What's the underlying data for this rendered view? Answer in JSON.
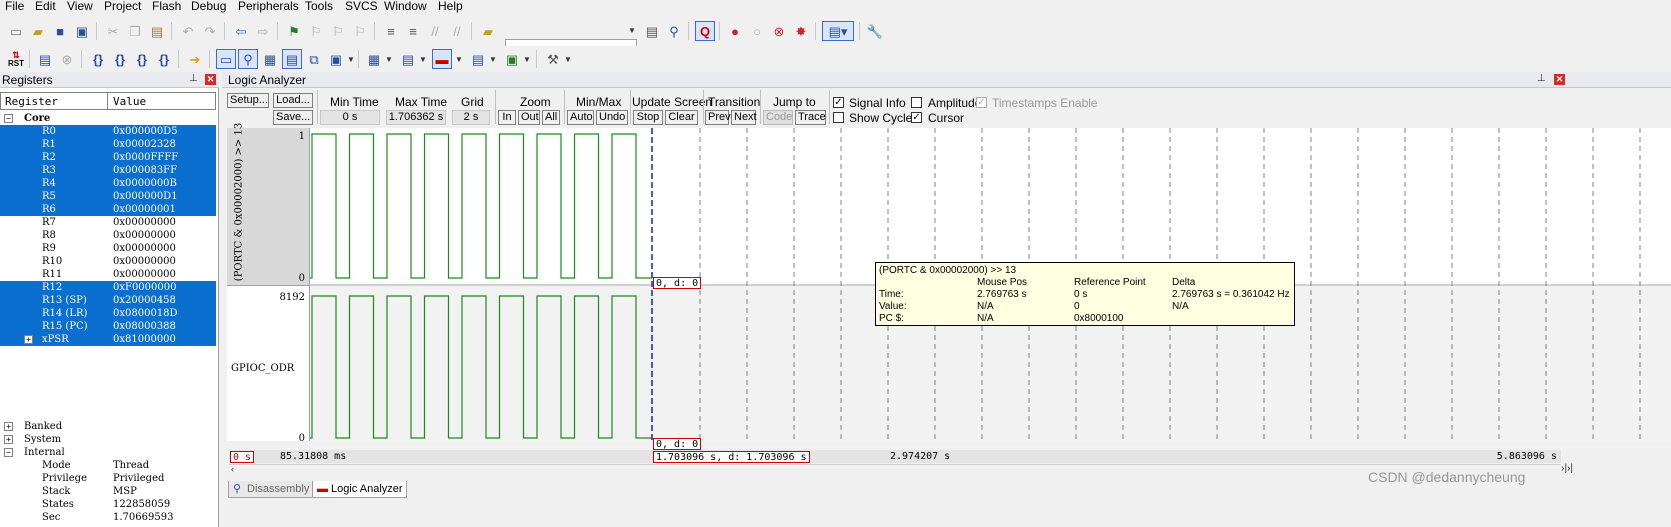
{
  "menu": [
    "File",
    "Edit",
    "View",
    "Project",
    "Flash",
    "Debug",
    "Peripherals",
    "Tools",
    "SVCS",
    "Window",
    "Help"
  ],
  "toolbar2": {
    "rst_label": "RST"
  },
  "registers": {
    "title": "Registers",
    "col_register": "Register",
    "col_value": "Value",
    "core_label": "Core",
    "rows": [
      {
        "name": "R0",
        "value": "0x000000D5",
        "selected": true
      },
      {
        "name": "R1",
        "value": "0x00002328",
        "selected": true
      },
      {
        "name": "R2",
        "value": "0x0000FFFF",
        "selected": true
      },
      {
        "name": "R3",
        "value": "0x000083FF",
        "selected": true
      },
      {
        "name": "R4",
        "value": "0x0000000B",
        "selected": true
      },
      {
        "name": "R5",
        "value": "0x000000D1",
        "selected": true
      },
      {
        "name": "R6",
        "value": "0x00000001",
        "selected": true
      },
      {
        "name": "R7",
        "value": "0x00000000",
        "selected": false
      },
      {
        "name": "R8",
        "value": "0x00000000",
        "selected": false
      },
      {
        "name": "R9",
        "value": "0x00000000",
        "selected": false
      },
      {
        "name": "R10",
        "value": "0x00000000",
        "selected": false
      },
      {
        "name": "R11",
        "value": "0x00000000",
        "selected": false
      },
      {
        "name": "R12",
        "value": "0xF0000000",
        "selected": true
      },
      {
        "name": "R13 (SP)",
        "value": "0x20000458",
        "selected": true
      },
      {
        "name": "R14 (LR)",
        "value": "0x0800018D",
        "selected": true
      },
      {
        "name": "R15 (PC)",
        "value": "0x08000388",
        "selected": true
      },
      {
        "name": "xPSR",
        "value": "0x81000000",
        "selected": true
      }
    ],
    "groups": [
      "Banked",
      "System",
      "Internal"
    ],
    "internal": [
      {
        "name": "Mode",
        "value": "Thread"
      },
      {
        "name": "Privilege",
        "value": "Privileged"
      },
      {
        "name": "Stack",
        "value": "MSP"
      },
      {
        "name": "States",
        "value": "122858059"
      },
      {
        "name": "Sec",
        "value": "1.70669593"
      }
    ]
  },
  "logic_analyzer": {
    "title": "Logic Analyzer",
    "setup": "Setup...",
    "load": "Load...",
    "save": "Save...",
    "min_time_label": "Min Time",
    "min_time": "0 s",
    "max_time_label": "Max Time",
    "max_time": "1.706362 s",
    "grid_label": "Grid",
    "grid": "2 s",
    "zoom_label": "Zoom",
    "zoom_in": "In",
    "zoom_out": "Out",
    "zoom_all": "All",
    "minmax_label": "Min/Max",
    "auto": "Auto",
    "undo": "Undo",
    "update_label": "Update Screen",
    "stop": "Stop",
    "clear": "Clear",
    "transition_label": "Transition",
    "prev": "Prev",
    "next": "Next",
    "jump_label": "Jump to",
    "code": "Code",
    "trace": "Trace",
    "signal_info": "Signal Info",
    "show_cycles": "Show Cycles",
    "amplitude": "Amplitude",
    "cursor": "Cursor",
    "timestamps": "Timestamps Enable",
    "signal_info_checked": true,
    "show_cycles_checked": false,
    "amplitude_checked": false,
    "cursor_checked": true,
    "timestamps_checked": true,
    "signals": [
      {
        "name": "(PORTC & 0x00002000) >> 13",
        "max": "1",
        "min": "0",
        "readout": "0,  d: 0"
      },
      {
        "name": "GPIOC_ODR",
        "max": "8192",
        "min": "0",
        "readout": "0,  d: 0"
      }
    ],
    "pulse_count": 9,
    "tooltip": {
      "signal": "(PORTC & 0x00002000) >> 13",
      "col_mouse": "Mouse Pos",
      "col_ref": "Reference Point",
      "col_delta": "Delta",
      "row_time": "Time:",
      "row_value": "Value:",
      "row_pc": "PC $:",
      "time_mouse": "2.769763 s",
      "time_ref": "0 s",
      "time_delta": "2.769763 s = 0.361042 Hz",
      "value_mouse": "N/A",
      "value_ref": "0",
      "value_delta": "N/A",
      "pc_mouse": "N/A",
      "pc_ref": "0x8000100"
    },
    "timebar": {
      "start": "0 s",
      "left_time": "85.31808 ms",
      "cursor": "1.703096 s,  d: 1.703096 s",
      "mouse": "2.974207 s",
      "end": "5.863096 s"
    }
  },
  "tabs": [
    "Disassembly",
    "Logic Analyzer"
  ],
  "watermark": "CSDN @dedannycheung",
  "colors": {
    "selection": "#0b6fd0",
    "wave": "#1a8c1a",
    "cursor": "#1a35d4",
    "grid": "#808080"
  }
}
